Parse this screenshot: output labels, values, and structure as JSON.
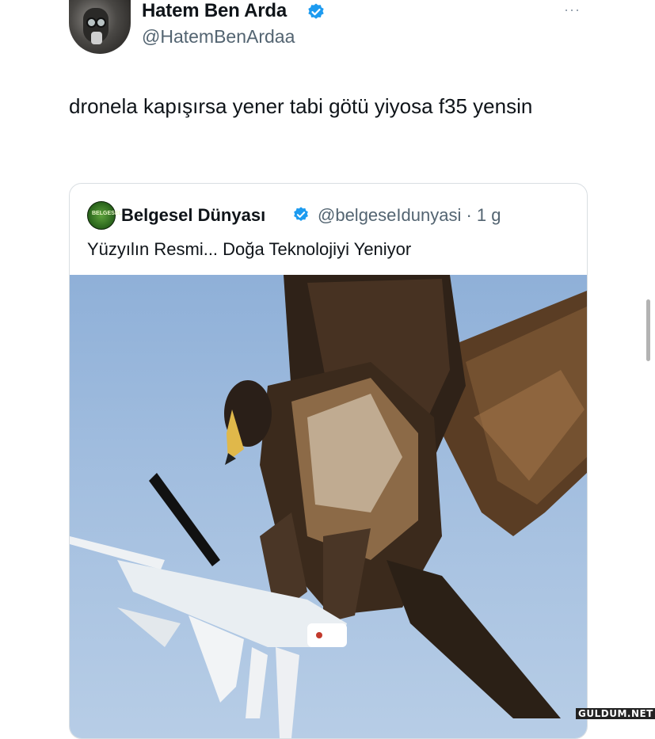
{
  "author": {
    "name": "Hatem Ben Arda",
    "handle": "@HatemBenArdaa"
  },
  "more_label": "···",
  "tweet": {
    "text": "dronela kapışırsa yener tabi götü yiyosa f35 yensin"
  },
  "quoted": {
    "avatar_text": "BELGESEL",
    "name": "Belgesel Dünyası",
    "handle_time": "@belgeseIdunyasi · 1 g",
    "text": "Yüzyılın Resmi... Doğa Teknolojiyi Yeniyor"
  },
  "watermark": "GULDUM.NET",
  "colors": {
    "verified": "#1d9bf0",
    "secondary_text": "#536471",
    "border": "#d9dee2"
  }
}
